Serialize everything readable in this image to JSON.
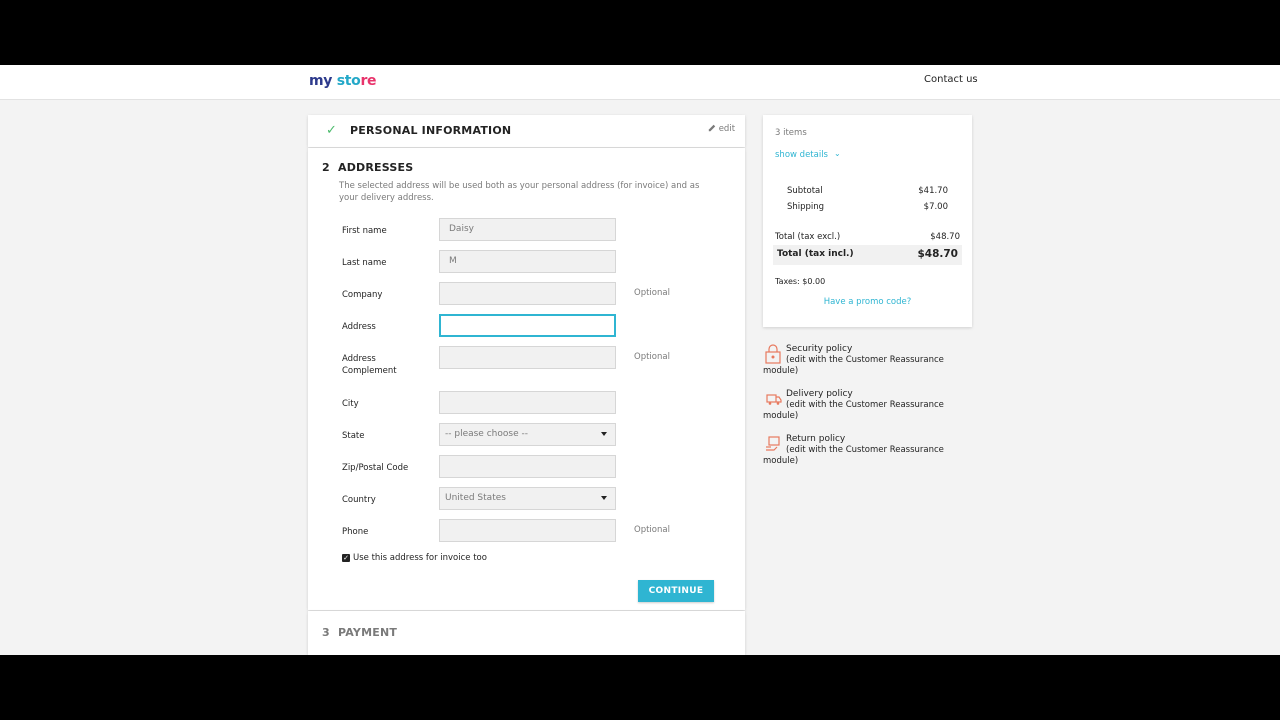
{
  "header": {
    "logo": {
      "part1": "my",
      "part2": " sto",
      "part3": "re"
    },
    "contact": "Contact us"
  },
  "step1": {
    "title": "PERSONAL INFORMATION",
    "edit": "edit"
  },
  "step2": {
    "number": "2",
    "title": "ADDRESSES",
    "description": "The selected address will be used both as your personal address (for invoice) and as your delivery address.",
    "fields": {
      "first_name": {
        "label": "First name",
        "value": "Daisy"
      },
      "last_name": {
        "label": "Last name",
        "value": "M"
      },
      "company": {
        "label": "Company",
        "value": "",
        "hint": "Optional"
      },
      "address": {
        "label": "Address",
        "value": ""
      },
      "address_complement": {
        "label_line1": "Address",
        "label_line2": "Complement",
        "value": "",
        "hint": "Optional"
      },
      "city": {
        "label": "City",
        "value": ""
      },
      "state": {
        "label": "State",
        "value": "-- please choose --"
      },
      "zip": {
        "label": "Zip/Postal Code",
        "value": ""
      },
      "country": {
        "label": "Country",
        "value": "United States"
      },
      "phone": {
        "label": "Phone",
        "value": "",
        "hint": "Optional"
      }
    },
    "use_for_invoice": "Use this address for invoice too",
    "continue": "CONTINUE"
  },
  "step3": {
    "number": "3",
    "title": "PAYMENT"
  },
  "summary": {
    "items": "3 items",
    "show_details": "show details",
    "subtotal_label": "Subtotal",
    "subtotal_value": "$41.70",
    "shipping_label": "Shipping",
    "shipping_value": "$7.00",
    "total_excl_label": "Total (tax excl.)",
    "total_excl_value": "$48.70",
    "total_incl_label": "Total (tax incl.)",
    "total_incl_value": "$48.70",
    "taxes": "Taxes: $0.00",
    "promo": "Have a promo code?"
  },
  "reassurance": [
    {
      "title": "Security policy",
      "desc1": "(edit with the Customer Reassurance",
      "desc2": "module)"
    },
    {
      "title": "Delivery policy",
      "desc1": "(edit with the Customer Reassurance",
      "desc2": "module)"
    },
    {
      "title": "Return policy",
      "desc1": "(edit with the Customer Reassurance",
      "desc2": "module)"
    }
  ],
  "colors": {
    "accent": "#2fb5d2",
    "check": "#4cbb6c",
    "icon": "#e8795e"
  }
}
